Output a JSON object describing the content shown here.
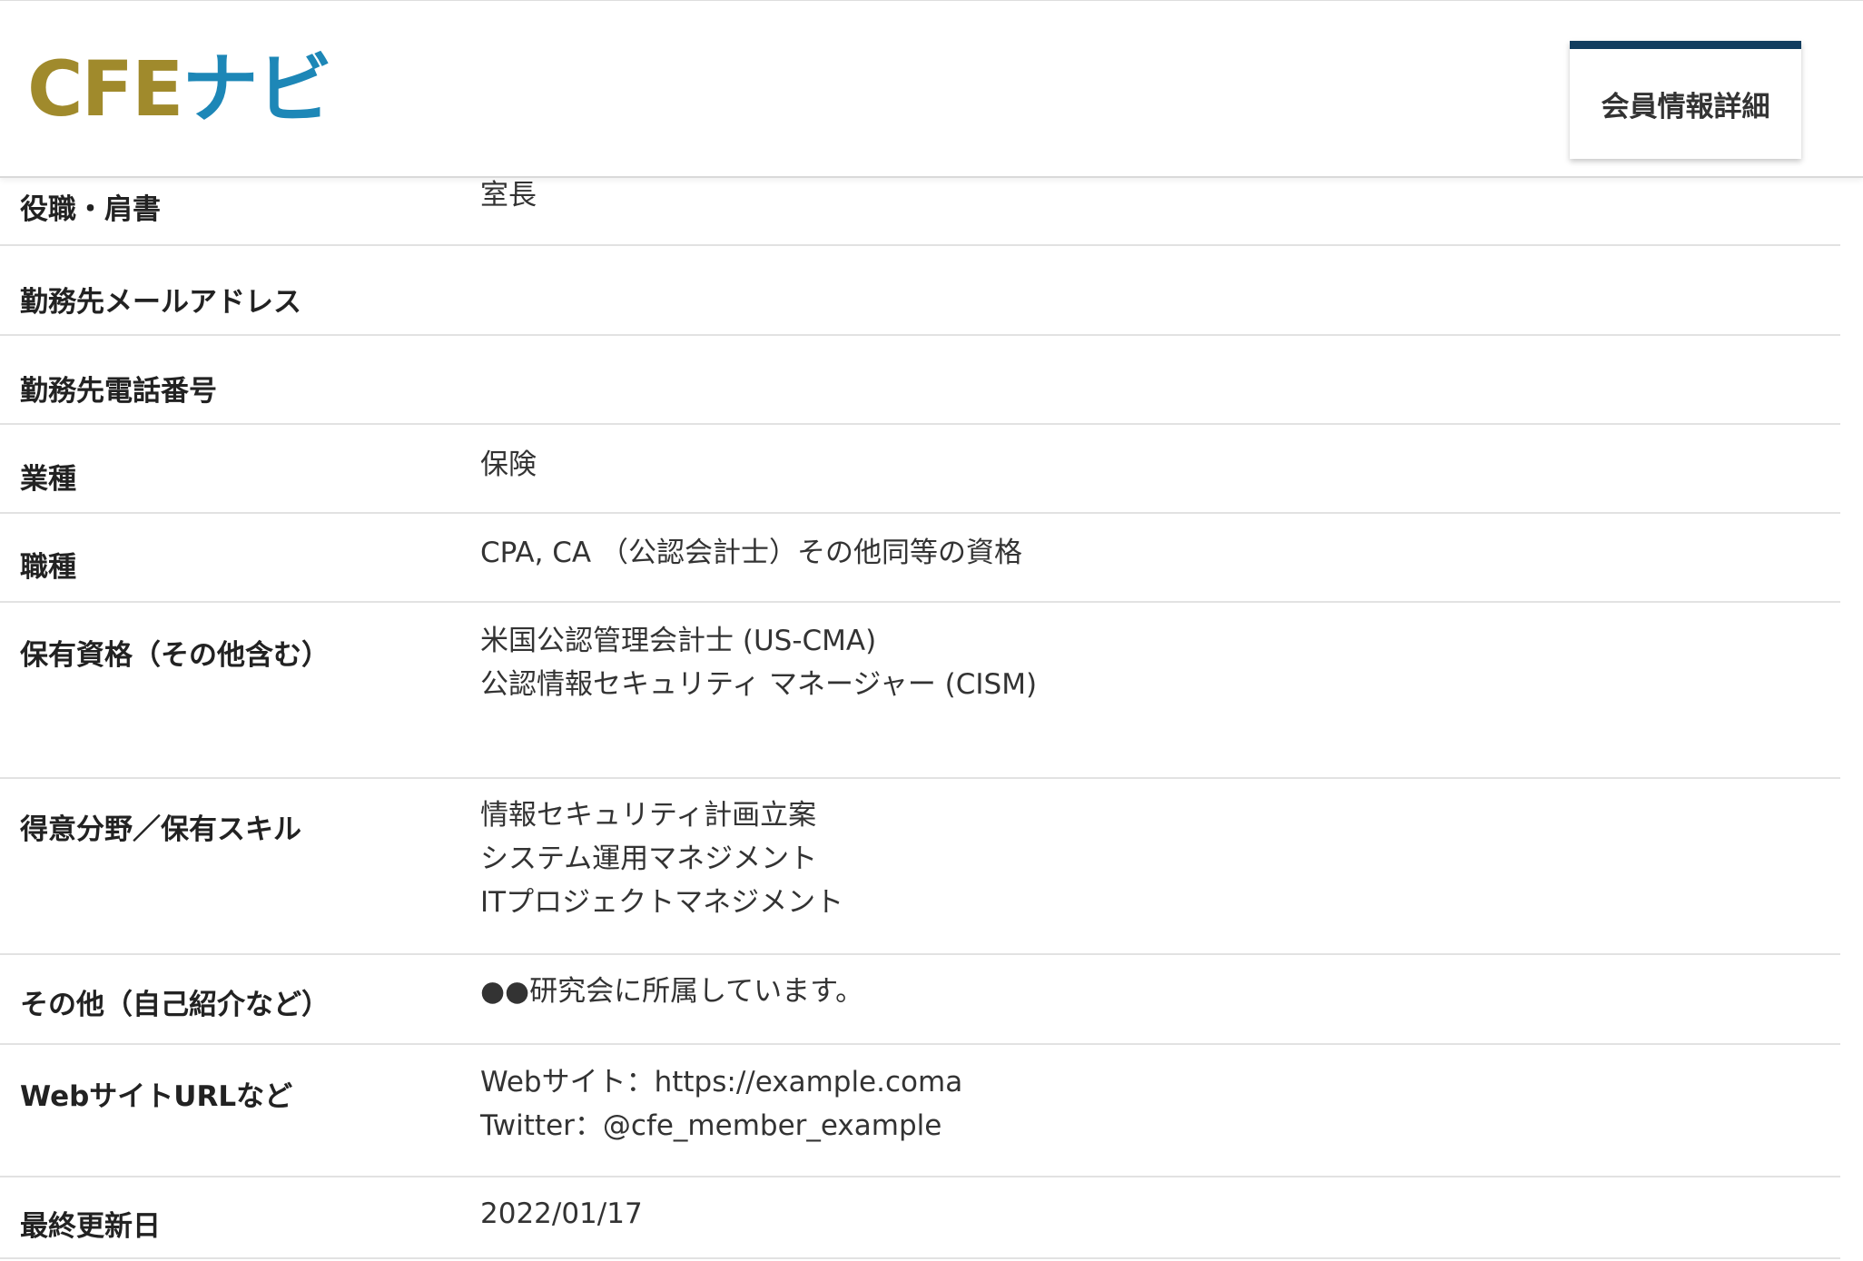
{
  "header": {
    "logo_part1": "CFE",
    "logo_part2": "ナビ",
    "tab_label": "会員情報詳細"
  },
  "colors": {
    "logo_gold": "#a08a2c",
    "logo_blue": "#1d87b7",
    "tab_accent": "#123d5f"
  },
  "rows": [
    {
      "label": "役職・肩書",
      "values": [
        "室長"
      ]
    },
    {
      "label": "勤務先メールアドレス",
      "values": []
    },
    {
      "label": "勤務先電話番号",
      "values": []
    },
    {
      "label": "業種",
      "values": [
        "保険"
      ]
    },
    {
      "label": "職種",
      "values": [
        "CPA, CA （公認会計士）その他同等の資格"
      ]
    },
    {
      "label": "保有資格（その他含む）",
      "values": [
        "米国公認管理会計士 (US-CMA)",
        "公認情報セキュリティ マネージャー (CISM)"
      ]
    },
    {
      "label": "得意分野／保有スキル",
      "values": [
        "情報セキュリティ計画立案",
        "システム運用マネジメント",
        "ITプロジェクトマネジメント"
      ]
    },
    {
      "label": "その他（自己紹介など）",
      "values": [
        "●●研究会に所属しています。"
      ]
    },
    {
      "label": "WebサイトURLなど",
      "values": [
        "Webサイト：https://example.coma",
        "Twitter：@cfe_member_example"
      ]
    },
    {
      "label": "最終更新日",
      "values": [
        "2022/01/17"
      ]
    }
  ]
}
